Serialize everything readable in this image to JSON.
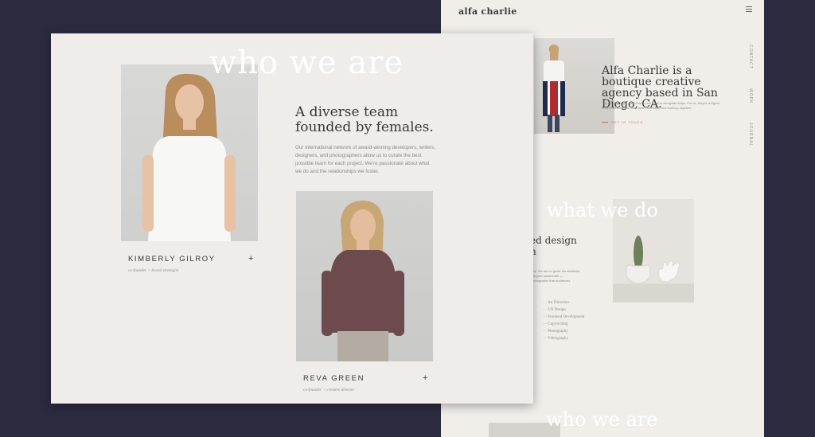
{
  "back_page": {
    "logo": "alfa charlie",
    "side_nav": [
      "CONTACT",
      "WORK",
      "JOURNAL"
    ],
    "hero_title": "Alfa Charlie is a boutique creative agency based in San Diego, CA.",
    "hero_body": "The nautical flags, Alfa Charlie, are code to alongside ships. For us, they're a signal to defy conventions, start fresh, and seek new territory, together.",
    "cta": "GET IN TOUCH",
    "section_title": "what we do",
    "services_heading": "ed design\nh",
    "services_body": "meaningful. We aim to guide the aesthetic that allows your passionate — design/photographs that audiences.",
    "services": [
      "Art Direction",
      "UX Design",
      "Frontend Development",
      "Copywriting",
      "Photography",
      "Videography"
    ],
    "bottom_title": "who we are"
  },
  "front_page": {
    "section_title": "who we are",
    "title": "A diverse team founded by females.",
    "intro": "Our international network of award-winning developers, writers, designers, and photographers allow us to curate the best possible team for each project. We're passionate about what we do and the relationships we foster.",
    "members": [
      {
        "name": "KIMBERLY GILROY",
        "role": "co-founder + brand strategist"
      },
      {
        "name": "REVA GREEN",
        "role": "co-founder + creative director"
      }
    ],
    "expand_label": "+"
  },
  "colors": {
    "background": "#2c2a3f",
    "page": "#efecea",
    "accent": "#c0724a",
    "text": "#3a3634"
  }
}
